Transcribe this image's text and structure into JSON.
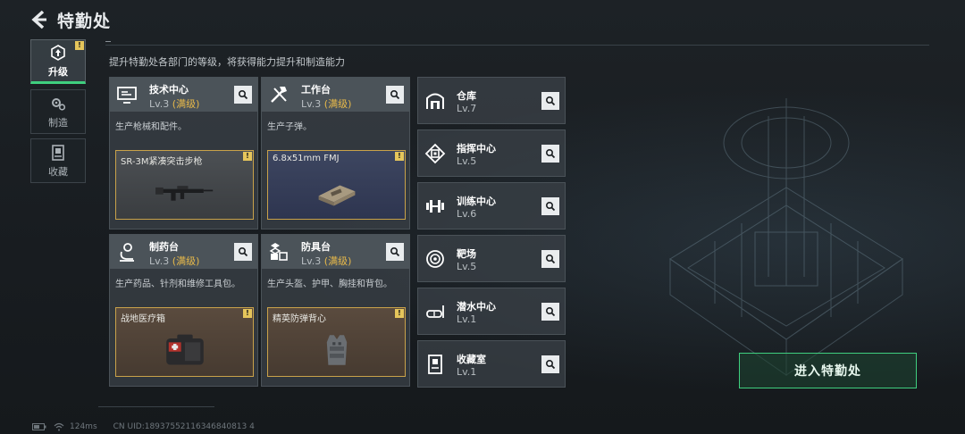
{
  "header": {
    "title": "特勤处",
    "subtitle": "提升特勤处各部门的等级，将获得能力提升和制造能力"
  },
  "side_nav": [
    {
      "label": "升级",
      "icon": "upgrade-icon",
      "active": true,
      "badge": "!"
    },
    {
      "label": "制造",
      "icon": "gears-icon",
      "active": false
    },
    {
      "label": "收藏",
      "icon": "collection-icon",
      "active": false
    }
  ],
  "big_cards": [
    {
      "name": "技术中心",
      "level": "Lv.3",
      "max": "(满级)",
      "desc": "生产枪械和配件。",
      "icon": "monitor-icon",
      "item": "SR-3M紧凑突击步枪",
      "badge": "!"
    },
    {
      "name": "工作台",
      "level": "Lv.3",
      "max": "(满级)",
      "desc": "生产子弹。",
      "icon": "tools-icon",
      "item": "6.8x51mm FMJ",
      "badge": "!"
    },
    {
      "name": "制药台",
      "level": "Lv.3",
      "max": "(满级)",
      "desc": "生产药品、针剂和维修工具包。",
      "icon": "microscope-icon",
      "item": "战地医疗箱",
      "badge": "!"
    },
    {
      "name": "防具台",
      "level": "Lv.3",
      "max": "(满级)",
      "desc": "生产头盔、护甲、胸挂和背包。",
      "icon": "armor-blocks-icon",
      "item": "精英防弹背心",
      "badge": "!"
    }
  ],
  "small_cards": [
    {
      "name": "仓库",
      "level": "Lv.7",
      "icon": "warehouse-icon"
    },
    {
      "name": "指挥中心",
      "level": "Lv.5",
      "icon": "command-chip-icon"
    },
    {
      "name": "训练中心",
      "level": "Lv.6",
      "icon": "dumbbell-icon"
    },
    {
      "name": "靶场",
      "level": "Lv.5",
      "icon": "target-icon"
    },
    {
      "name": "潜水中心",
      "level": "Lv.1",
      "icon": "diving-mask-icon"
    },
    {
      "name": "收藏室",
      "level": "Lv.1",
      "icon": "collection-room-icon"
    }
  ],
  "enter_button": "进入特勤处",
  "footer": {
    "latency": "124ms",
    "uid": "CN UID:18937552116346840813 4"
  },
  "colors": {
    "accent_green": "#3fcf7f",
    "max_level": "#e7b94a",
    "badge_yellow": "#e5c55b"
  }
}
